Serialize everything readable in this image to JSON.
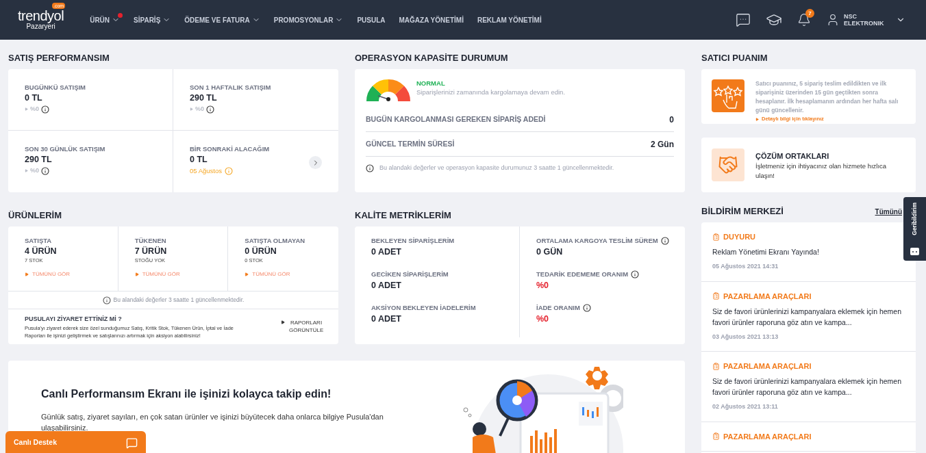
{
  "header": {
    "logo": "trendyol",
    "logo_badge": ".com",
    "logo_sub": "Pazaryeri",
    "nav": [
      {
        "label": "ÜRÜN",
        "expandable": true,
        "dot": true
      },
      {
        "label": "SİPARİŞ",
        "expandable": true,
        "dot": false
      },
      {
        "label": "ÖDEME VE FATURA",
        "expandable": true,
        "dot": false
      },
      {
        "label": "PROMOSYONLAR",
        "expandable": true,
        "dot": false
      },
      {
        "label": "PUSULA",
        "expandable": false,
        "dot": false
      },
      {
        "label": "MAĞAZA YÖNETİMİ",
        "expandable": false,
        "dot": false
      },
      {
        "label": "REKLAM YÖNETİMİ",
        "expandable": false,
        "dot": false
      }
    ],
    "notification_count": "7",
    "user": "NSC ELEKTRONIK"
  },
  "sales": {
    "title": "SATIŞ PERFORMANSIM",
    "items": [
      {
        "kind": "trend",
        "label": "BUGÜNKÜ SATIŞIM",
        "value": "0 TL",
        "sub": "%0"
      },
      {
        "kind": "trend",
        "label": "SON 1 HAFTALIK SATIŞIM",
        "value": "290 TL",
        "sub": "%0"
      },
      {
        "kind": "trend",
        "label": "SON 30 GÜNLÜK SATIŞIM",
        "value": "290 TL",
        "sub": "%0"
      },
      {
        "kind": "date",
        "label": "BİR SONRAKİ ALACAĞIM",
        "value": "0 TL",
        "sub": "05 Ağustos"
      }
    ]
  },
  "operation": {
    "title": "OPERASYON KAPASİTE DURUMUM",
    "status": "NORMAL",
    "message": "Siparişlerinizi zamanında kargolamaya devam edin.",
    "rows": [
      {
        "label": "BUGÜN KARGOLANMASI GEREKEN SİPARİŞ ADEDİ",
        "value": "0"
      },
      {
        "label": "GÜNCEL TERMİN SÜRESİ",
        "value": "2 Gün"
      }
    ],
    "note": "Bu alandaki değerler ve operasyon kapasite durumunuz 3 saatte 1 güncellenmektedir."
  },
  "seller_score": {
    "title": "SATICI PUANIM",
    "text": "Satıcı puanınız, 5 sipariş teslim edildikten ve ilk siparişiniz üzerinden 15 gün geçtikten sonra hesaplanır. İlk hesaplamanın ardından her hafta salı günü güncellenir.",
    "link": "Detaylı bilgi için tıklayınız"
  },
  "partners": {
    "title": "ÇÖZÜM ORTAKLARI",
    "text": "İşletmeniz için ihtiyacınız olan hizmete hızlıca ulaşın!"
  },
  "products": {
    "title": "ÜRÜNLERİM",
    "items": [
      {
        "label": "SATIŞTA",
        "value": "4 ÜRÜN",
        "sub": "7 STOK",
        "link": "TÜMÜNÜ GÖR"
      },
      {
        "label": "TÜKENEN",
        "value": "7 ÜRÜN",
        "sub": "STOĞU YOK",
        "link": "TÜMÜNÜ GÖR"
      },
      {
        "label": "SATIŞTA OLMAYAN",
        "value": "0 ÜRÜN",
        "sub": "0 STOK",
        "link": "TÜMÜNÜ GÖR"
      }
    ],
    "note": "Bu alandaki değerler 3 saatte 1 güncellenmektedir.",
    "promo_title": "PUSULAYI ZİYARET ETTİNİZ Mİ ?",
    "promo_text": "Pusula'yı ziyaret ederek size özel sunduğumuz Satış, Kritik Stok, Tükenen Ürün, İptal ve İade Raporları ile işinizi geliştirmek ve satışlarınızı artırmak için aksiyon alabilirsiniz!",
    "promo_button": "RAPORLARI GÖRÜNTÜLE"
  },
  "quality": {
    "title": "KALİTE METRİKLERİM",
    "columns": [
      [
        {
          "label": "BEKLEYEN SİPARİŞLERİM",
          "value": "0 ADET",
          "info": false,
          "alert": false
        },
        {
          "label": "GECİKEN SİPARİŞLERİM",
          "value": "0 ADET",
          "info": false,
          "alert": false
        },
        {
          "label": "AKSİYON BEKLEYEN İADELERİM",
          "value": "0 ADET",
          "info": false,
          "alert": false
        }
      ],
      [
        {
          "label": "ORTALAMA KARGOYA TESLİM SÜREM",
          "value": "0 GÜN",
          "info": true,
          "alert": false
        },
        {
          "label": "TEDARİK EDEMEME ORANIM",
          "value": "%0",
          "info": true,
          "alert": true
        },
        {
          "label": "İADE ORANIM",
          "value": "%0",
          "info": true,
          "alert": true
        }
      ]
    ]
  },
  "notifications": {
    "title": "BİLDİRİM MERKEZİ",
    "all_link": "Tümünü",
    "items": [
      {
        "category": "DUYURU",
        "text": "Reklam Yönetimi Ekranı Yayında!",
        "date": "05 Ağustos 2021 14:31"
      },
      {
        "category": "PAZARLAMA ARAÇLARI",
        "text": "Siz de favori ürünlerinizi kampanyalara eklemek için hemen favori ürünler raporuna göz atın ve kampa...",
        "date": "03 Ağustos 2021 13:13"
      },
      {
        "category": "PAZARLAMA ARAÇLARI",
        "text": "Siz de favori ürünlerinizi kampanyalara eklemek için hemen favori ürünler raporuna göz atın ve kampa...",
        "date": "02 Ağustos 2021 13:11"
      },
      {
        "category": "PAZARLAMA ARAÇLARI"
      }
    ]
  },
  "banner": {
    "title": "Canlı Performansım Ekranı ile işinizi kolayca takip edin!",
    "text": "Günlük satış, ziyaret sayıları, en çok satan ürünler ve işinizi büyütecek daha onlarca bilgiye Pusula'dan ulaşabilirsiniz."
  },
  "feedback_tab": "Geribildirim",
  "live_support": "Canlı Destek"
}
